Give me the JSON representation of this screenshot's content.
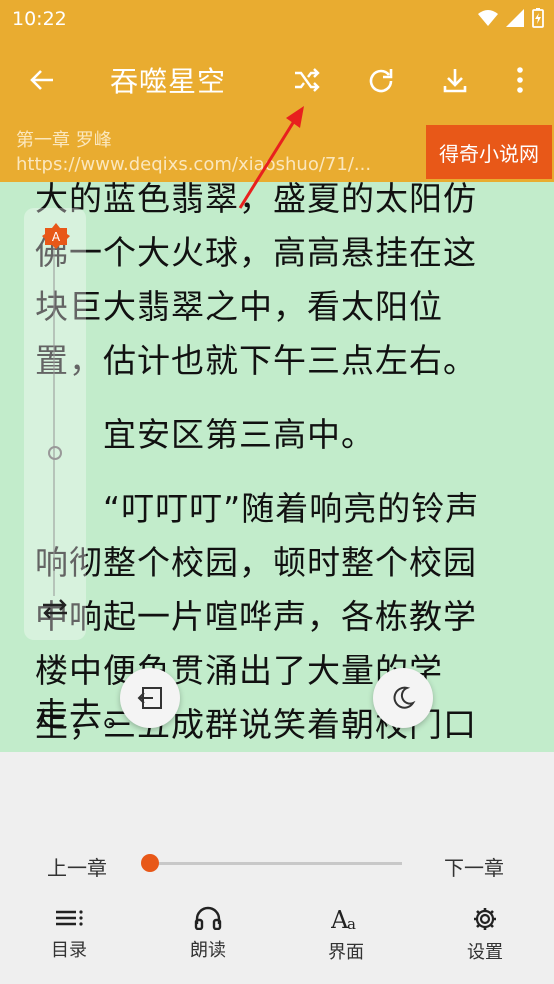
{
  "status": {
    "time": "10:22"
  },
  "toolbar": {
    "title": "吞噬星空",
    "back_icon": "arrow-left-icon",
    "actions": [
      "shuffle-icon",
      "refresh-icon",
      "download-icon",
      "more-vert-icon"
    ]
  },
  "subbar": {
    "chapter": "第一章 罗峰",
    "url": "https://www.deqixs.com/xiaoshuo/71/...",
    "source_button": "得奇小说网"
  },
  "content": {
    "lines": [
      "大的蓝色翡翠，盛夏的太阳仿",
      "佛一个大火球，高高悬挂在这",
      "块巨大翡翠之中，看太阳位",
      "置，估计也就下午三点左右。",
      "　　宜安区第三高中。",
      "　　“叮叮叮”随着响亮的铃声",
      "响彻整个校园，顿时整个校园",
      "中响起一片喧哗声，各栋教学",
      "楼中便鱼贯涌出了大量的学",
      "生，三五成群说笑着朝校门口",
      "走去。"
    ]
  },
  "fabs": {
    "left": "exit-reading-icon",
    "right": "night-mode-icon"
  },
  "progress": {
    "prev": "上一章",
    "next": "下一章",
    "value": 0.0
  },
  "bottom_nav": [
    {
      "label": "目录",
      "icon": "list-icon"
    },
    {
      "label": "朗读",
      "icon": "headphones-icon"
    },
    {
      "label": "界面",
      "icon": "font-size-icon"
    },
    {
      "label": "设置",
      "icon": "gear-icon"
    }
  ],
  "colors": {
    "accent": "#e9ac30",
    "source": "#e85818",
    "page": "#c2eccb"
  }
}
